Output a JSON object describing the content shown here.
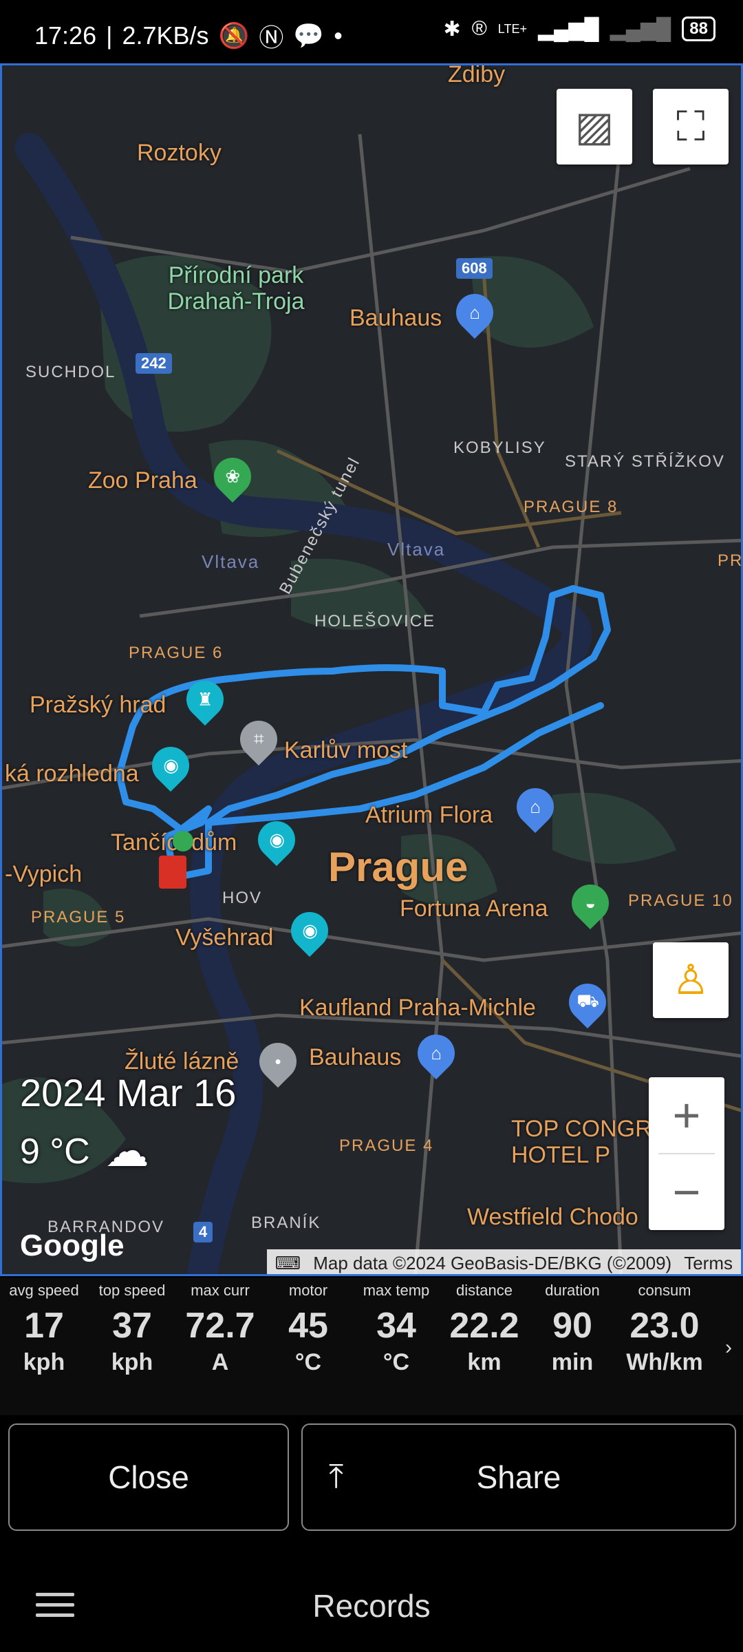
{
  "status": {
    "time": "17:26",
    "speed": "2.7KB/s",
    "battery": "88",
    "network": "LTE+"
  },
  "map": {
    "places": [
      {
        "id": "roztoky",
        "text": "Roztoky"
      },
      {
        "id": "zdiby",
        "text": "Zdiby"
      },
      {
        "id": "park",
        "text": "Přírodní park Drahaň-Troja"
      },
      {
        "id": "bauhaus1",
        "text": "Bauhaus"
      },
      {
        "id": "zoo",
        "text": "Zoo Praha"
      },
      {
        "id": "prazsky",
        "text": "Pražský hrad"
      },
      {
        "id": "karluv",
        "text": "Karlův most"
      },
      {
        "id": "rozhledna",
        "text": "ká rozhledna"
      },
      {
        "id": "atrium",
        "text": "Atrium Flora"
      },
      {
        "id": "tancici",
        "text": "Tančící dům"
      },
      {
        "id": "vypich",
        "text": "-Vypich"
      },
      {
        "id": "prague",
        "text": "Prague"
      },
      {
        "id": "fortuna",
        "text": "Fortuna Arena"
      },
      {
        "id": "vysehrad",
        "text": "Vyšehrad"
      },
      {
        "id": "kaufland",
        "text": "Kaufland Praha-Michle"
      },
      {
        "id": "bauhaus2",
        "text": "Bauhaus"
      },
      {
        "id": "zlute",
        "text": "Žluté lázně"
      },
      {
        "id": "topcongress",
        "text": "TOP CONGR HOTEL P"
      },
      {
        "id": "westfield",
        "text": "Westfield Chodo"
      }
    ],
    "districts": [
      "SUCHDOL",
      "KOBYLISY",
      "STARÝ STŘÍŽKOV",
      "PRAGUE 8",
      "HOLEŠOVICE",
      "PRAGUE 6",
      "PRAGUE 5",
      "PRAGUE 10",
      "PRAGUE 4",
      "BRANÍK",
      "BARRANDOV",
      "HOV",
      "PR"
    ],
    "river": [
      "Vltava",
      "Vltava"
    ],
    "tunnel": "Bubenečský tunel",
    "roads": [
      "608",
      "242",
      "4"
    ],
    "date": "2024 Mar 16",
    "temperature": "9 °C",
    "google": "Google",
    "attribution": "Map data ©2024 GeoBasis-DE/BKG (©2009)",
    "terms": "Terms"
  },
  "stats": [
    {
      "label": "avg speed",
      "value": "17",
      "unit": "kph"
    },
    {
      "label": "top speed",
      "value": "37",
      "unit": "kph"
    },
    {
      "label": "max curr",
      "value": "72.7",
      "unit": "A"
    },
    {
      "label": "motor",
      "value": "45",
      "unit": "°C"
    },
    {
      "label": "max temp",
      "value": "34",
      "unit": "°C"
    },
    {
      "label": "distance",
      "value": "22.2",
      "unit": "km"
    },
    {
      "label": "duration",
      "value": "90",
      "unit": "min"
    },
    {
      "label": "consum",
      "value": "23.0",
      "unit": "Wh/km"
    }
  ],
  "buttons": {
    "close": "Close",
    "share": "Share"
  },
  "bottom": {
    "title": "Records"
  },
  "colors": {
    "route": "#2f8ee8",
    "accent": "#2f6fd6"
  }
}
